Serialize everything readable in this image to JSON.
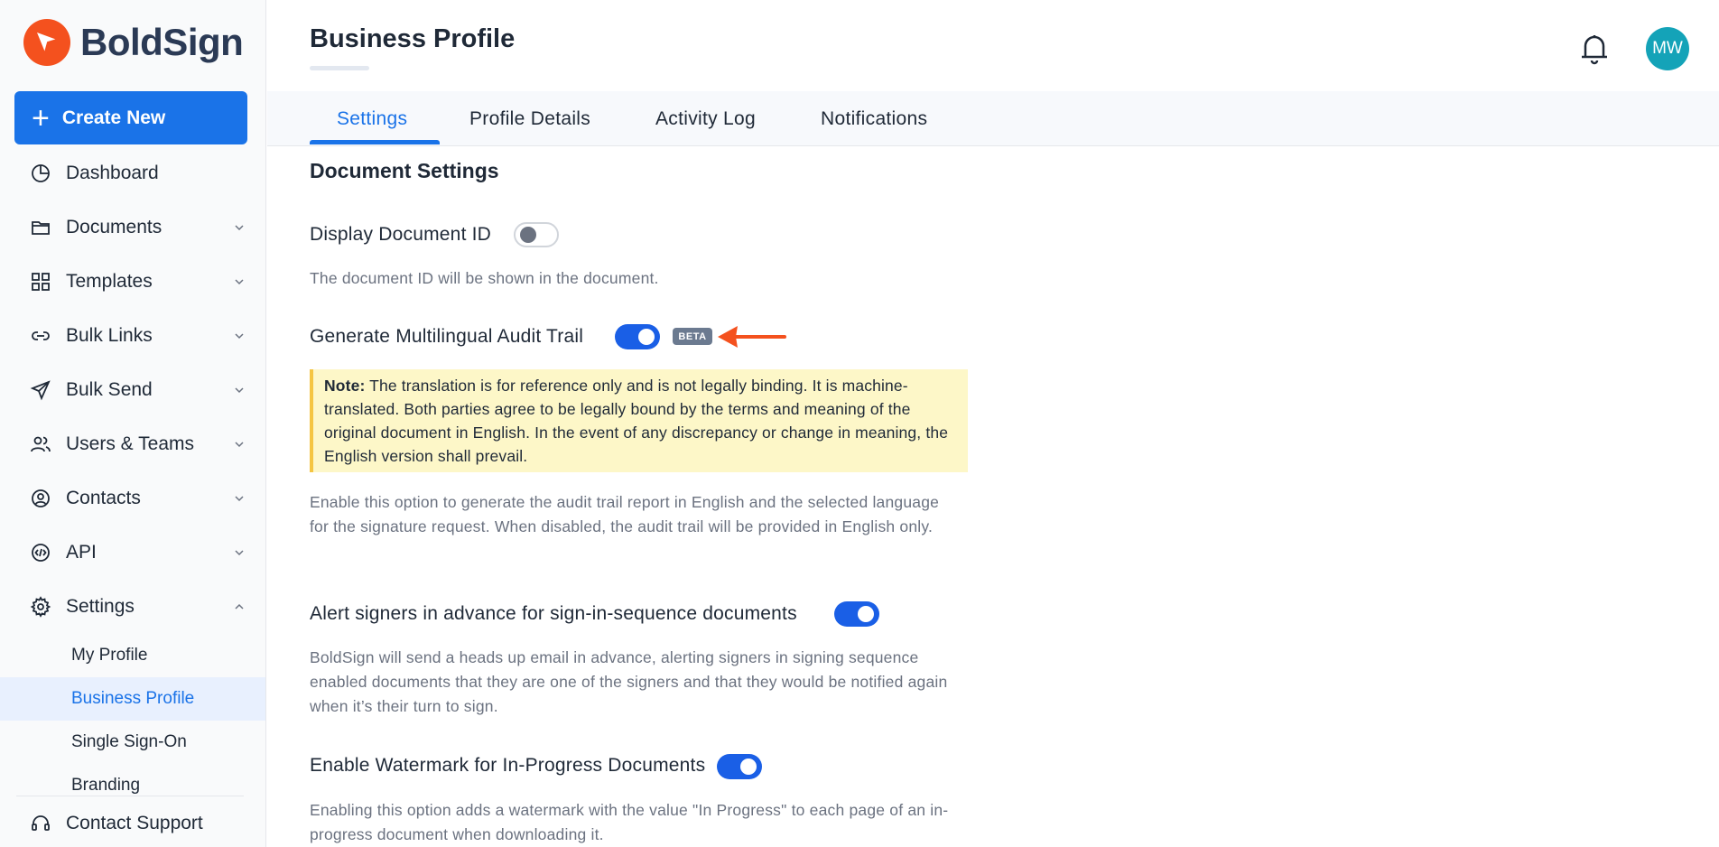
{
  "brand": {
    "name": "BoldSign",
    "accent": "#1a73e8",
    "logo_color": "#f4511e"
  },
  "sidebar": {
    "create_label": "Create New",
    "items": [
      {
        "label": "Dashboard",
        "icon": "pie-chart-icon",
        "expandable": false
      },
      {
        "label": "Documents",
        "icon": "folder-icon",
        "expandable": true
      },
      {
        "label": "Templates",
        "icon": "grid-icon",
        "expandable": true
      },
      {
        "label": "Bulk Links",
        "icon": "link-icon",
        "expandable": true
      },
      {
        "label": "Bulk Send",
        "icon": "send-icon",
        "expandable": true
      },
      {
        "label": "Users & Teams",
        "icon": "users-icon",
        "expandable": true
      },
      {
        "label": "Contacts",
        "icon": "contact-icon",
        "expandable": true
      },
      {
        "label": "API",
        "icon": "api-icon",
        "expandable": true
      },
      {
        "label": "Settings",
        "icon": "gear-icon",
        "expandable": true,
        "expanded": true
      }
    ],
    "settings_sub": [
      {
        "label": "My Profile",
        "active": false
      },
      {
        "label": "Business Profile",
        "active": true
      },
      {
        "label": "Single Sign-On",
        "active": false
      },
      {
        "label": "Branding",
        "active": false
      }
    ],
    "support_label": "Contact Support"
  },
  "header": {
    "title": "Business Profile",
    "avatar_initials": "MW"
  },
  "tabs": [
    {
      "label": "Settings",
      "active": true
    },
    {
      "label": "Profile Details",
      "active": false
    },
    {
      "label": "Activity Log",
      "active": false
    },
    {
      "label": "Notifications",
      "active": false
    }
  ],
  "content": {
    "section_title": "Document Settings",
    "display_doc_id": {
      "label": "Display Document ID",
      "enabled": false,
      "description": "The document ID will be shown in the document."
    },
    "multilingual": {
      "label": "Generate Multilingual Audit Trail",
      "enabled": true,
      "badge": "BETA",
      "note_prefix": "Note:",
      "note_text": " The translation is for reference only and is not legally binding. It is machine-translated. Both parties agree to be legally bound by the terms and meaning of the original document in English. In the event of any discrepancy or change in meaning, the English version shall prevail.",
      "description": "Enable this option to generate the audit trail report in English and the selected language for the signature request. When disabled, the audit trail will be provided in English only."
    },
    "alert_signers": {
      "label": "Alert signers in advance for sign-in-sequence documents",
      "enabled": true,
      "description": "BoldSign will send a heads up email in advance, alerting signers in signing sequence enabled documents that they are one of the signers and that they would be notified again when it’s their turn to sign."
    },
    "watermark": {
      "label": "Enable Watermark for In-Progress Documents",
      "enabled": true,
      "description": "Enabling this option adds a watermark with the value \"In Progress\" to each page of an in-progress document when downloading it."
    }
  }
}
